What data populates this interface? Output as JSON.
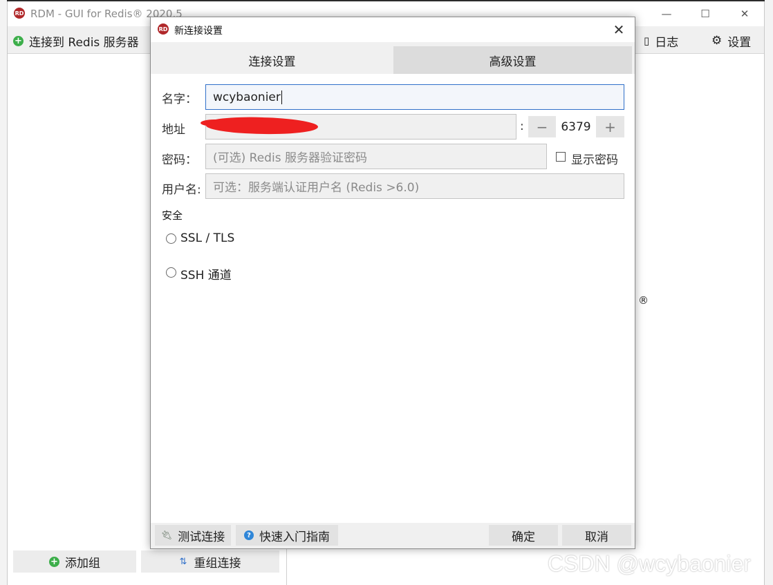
{
  "main_window": {
    "title": "RDM - GUI for Redis® 2020.5",
    "logo_text": "RD",
    "toolbar": {
      "connect_label": "连接到 Redis 服务器",
      "log_label": "日志",
      "settings_label": "设置"
    },
    "left_panel": {
      "add_group_label": "添加组",
      "reorder_label": "重组连接"
    },
    "reg_mark": "®"
  },
  "dialog": {
    "title": "新连接设置",
    "tabs": [
      {
        "label": "连接设置",
        "active": true
      },
      {
        "label": "高级设置",
        "active": false
      }
    ],
    "name_label": "名字：",
    "name_value": "wcybaonier",
    "address_label": "地址",
    "address_value": "",
    "port_separator": ":",
    "port_value": "6379",
    "port_minus": "−",
    "port_plus": "+",
    "password_label": "密码：",
    "password_placeholder": "(可选) Redis 服务器验证密码",
    "show_password_label": "显示密码",
    "show_password_checked": false,
    "username_label": "用户名:",
    "username_placeholder": "可选：服务端认证用户名 (Redis >6.0)",
    "security_label": "安全",
    "security_options": [
      {
        "label": "SSL / TLS",
        "selected": false
      },
      {
        "label": "SSH 通道",
        "selected": false
      }
    ],
    "buttons": {
      "test_label": "测试连接",
      "quickstart_label": "快速入门指南",
      "ok_label": "确定",
      "cancel_label": "取消"
    }
  },
  "watermark": "CSDN @wcybaonier",
  "colors": {
    "accent": "#2f6fc9",
    "brand": "#b0282a",
    "add_green": "#3cae4a",
    "help_blue": "#2f86d8",
    "redaction": "#ee2020"
  }
}
